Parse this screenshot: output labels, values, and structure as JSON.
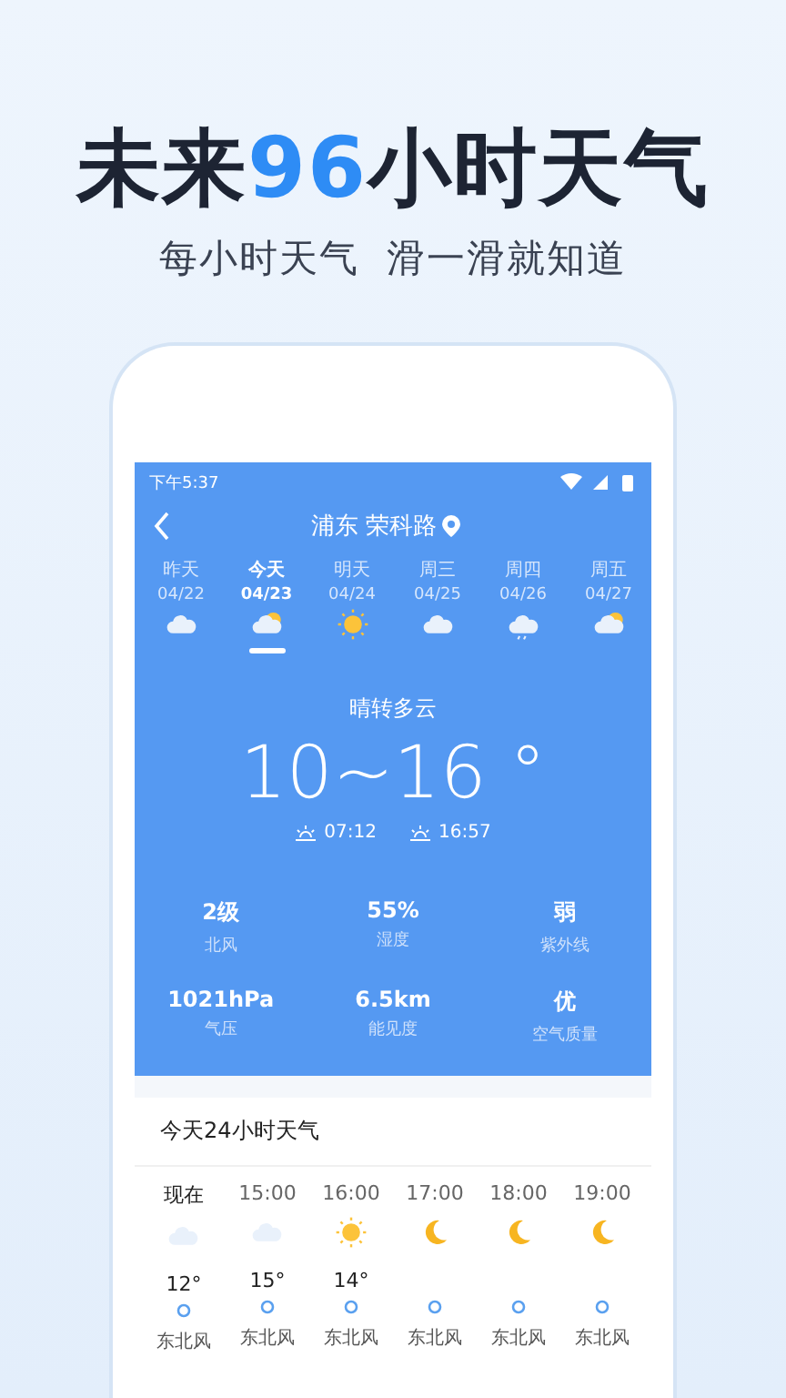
{
  "headline": [
    {
      "text": "未来",
      "accent": false
    },
    {
      "text": "96",
      "accent": true
    },
    {
      "text": "小时天气",
      "accent": false
    }
  ],
  "subtitle": "每小时天气  滑一滑就知道",
  "status_bar": {
    "time": "下午5:37"
  },
  "header": {
    "location": "浦东 荣科路"
  },
  "days": [
    {
      "name": "昨天",
      "date": "04/22",
      "kind": "cloud",
      "selected": false
    },
    {
      "name": "今天",
      "date": "04/23",
      "kind": "partly",
      "selected": true
    },
    {
      "name": "明天",
      "date": "04/24",
      "kind": "sun",
      "selected": false
    },
    {
      "name": "周三",
      "date": "04/25",
      "kind": "cloud",
      "selected": false
    },
    {
      "name": "周四",
      "date": "04/26",
      "kind": "rain",
      "selected": false
    },
    {
      "name": "周五",
      "date": "04/27",
      "kind": "partly",
      "selected": false
    }
  ],
  "today": {
    "condition": "晴转多云",
    "temperature": "10~16 °",
    "sunrise": "07:12",
    "sunset": "16:57"
  },
  "stats": [
    {
      "value": "2级",
      "label": "北风"
    },
    {
      "value": "55%",
      "label": "湿度"
    },
    {
      "value": "弱",
      "label": "紫外线"
    },
    {
      "value": "1021hPa",
      "label": "气压"
    },
    {
      "value": "6.5km",
      "label": "能见度"
    },
    {
      "value": "优",
      "label": "空气质量"
    }
  ],
  "hourly": {
    "title": "今天24小时天气",
    "hours": [
      {
        "time": "现在",
        "kind": "cloud",
        "temp": "12°",
        "wind": "东北风"
      },
      {
        "time": "15:00",
        "kind": "cloud",
        "temp": "15°",
        "wind": "东北风"
      },
      {
        "time": "16:00",
        "kind": "sun",
        "temp": "14°",
        "wind": "东北风"
      },
      {
        "time": "17:00",
        "kind": "moon",
        "wind": "东北风"
      },
      {
        "time": "18:00",
        "kind": "moon",
        "wind": "东北风"
      },
      {
        "time": "19:00",
        "kind": "moon",
        "wind": "东北风"
      }
    ]
  }
}
